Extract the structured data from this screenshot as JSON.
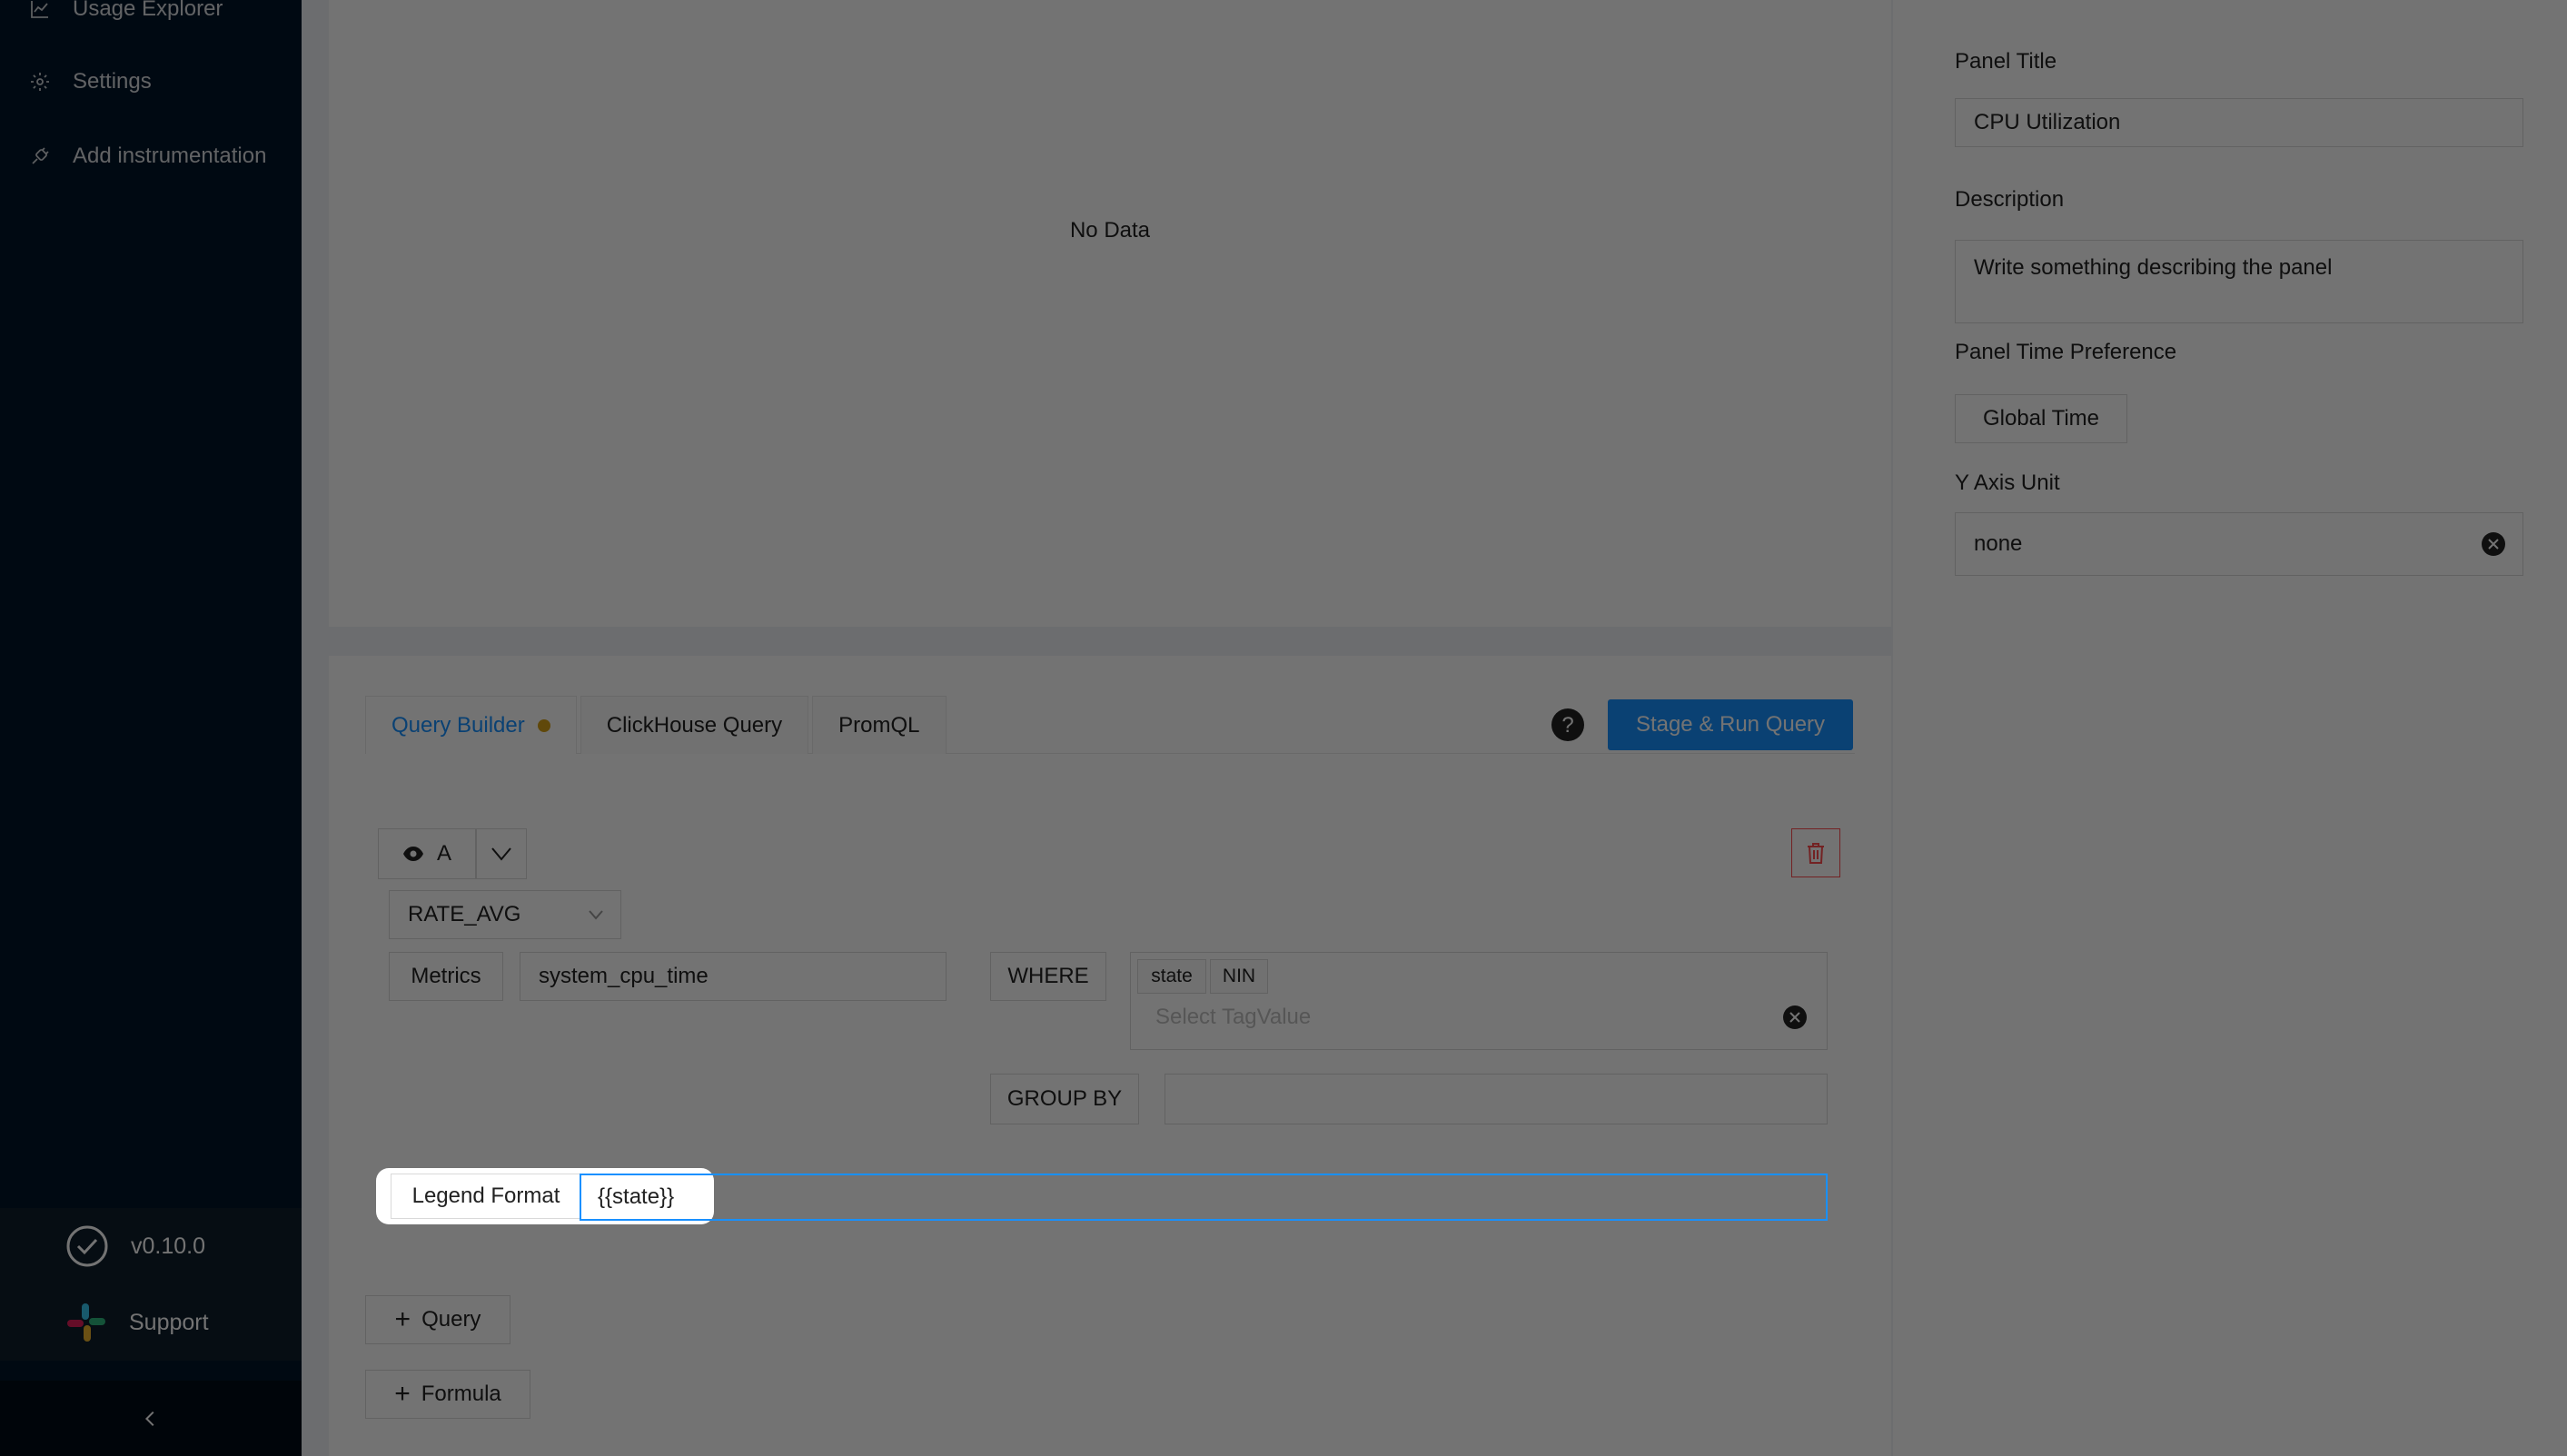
{
  "sidebar": {
    "items": [
      {
        "label": "Usage Explorer",
        "icon": "line-chart-icon"
      },
      {
        "label": "Settings",
        "icon": "gear-icon"
      },
      {
        "label": "Add instrumentation",
        "icon": "api-icon"
      }
    ],
    "version": "v0.10.0",
    "support": "Support"
  },
  "chart": {
    "no_data": "No Data"
  },
  "query": {
    "tabs": [
      "Query Builder",
      "ClickHouse Query",
      "PromQL"
    ],
    "run_label": "Stage & Run Query",
    "query_name": "A",
    "aggregation": "RATE_AVG",
    "metrics_label": "Metrics",
    "metric_value": "system_cpu_time",
    "where_label": "WHERE",
    "where_tags": [
      "state",
      "NIN"
    ],
    "tag_placeholder": "Select TagValue",
    "group_by_label": "GROUP BY",
    "legend_label": "Legend Format",
    "legend_value": "{{state}}",
    "add_query": "Query",
    "add_formula": "Formula"
  },
  "attributes": {
    "panel_title_label": "Panel Title",
    "panel_title_value": "CPU Utilization",
    "description_label": "Description",
    "description_placeholder": "Write something describing the  panel",
    "time_pref_label": "Panel Time Preference",
    "time_pref_value": "Global Time",
    "y_axis_label": "Y Axis Unit",
    "y_axis_value": "none"
  }
}
